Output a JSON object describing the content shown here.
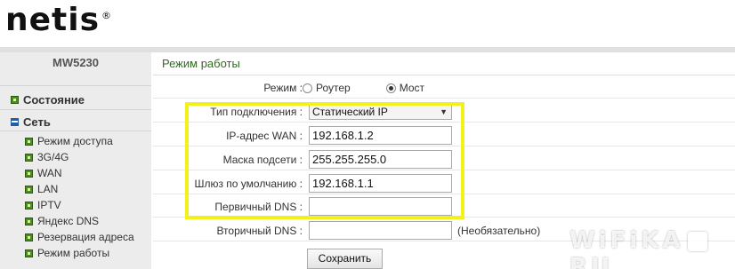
{
  "brand": {
    "logo_text": "netis",
    "registered_mark": "®"
  },
  "sidebar": {
    "model": "MW5230",
    "top_items": [
      {
        "label": "Состояние",
        "icon": "plus-square-icon"
      },
      {
        "label": "Сеть",
        "icon": "minus-square-icon"
      }
    ],
    "sub_items": [
      {
        "label": "Режим доступа"
      },
      {
        "label": "3G/4G"
      },
      {
        "label": "WAN"
      },
      {
        "label": "LAN"
      },
      {
        "label": "IPTV"
      },
      {
        "label": "Яндекс DNS"
      },
      {
        "label": "Резервация адреса"
      },
      {
        "label": "Режим работы"
      }
    ]
  },
  "main": {
    "section_title": "Режим работы",
    "mode": {
      "label": "Режим :",
      "options": [
        {
          "label": "Роутер",
          "selected": false
        },
        {
          "label": "Мост",
          "selected": true
        }
      ]
    },
    "fields": {
      "connection_type": {
        "label": "Тип подключения :",
        "value": "Статический IP"
      },
      "wan_ip": {
        "label": "IP-адрес WAN :",
        "value": "192.168.1.2"
      },
      "subnet_mask": {
        "label": "Маска подсети :",
        "value": "255.255.255.0"
      },
      "gateway": {
        "label": "Шлюз по умолчанию :",
        "value": "192.168.1.1"
      },
      "primary_dns": {
        "label": "Первичный DNS :",
        "value": ""
      },
      "secondary_dns": {
        "label": "Вторичный DNS :",
        "value": "",
        "note": "(Необязательно)"
      }
    },
    "save_label": "Сохранить"
  },
  "watermark": {
    "left": "WiFiKA",
    "right": "RU"
  },
  "colors": {
    "accent_green": "#2e6b1a",
    "highlight": "#f2f21a",
    "sidebar_bg": "#ececec"
  }
}
